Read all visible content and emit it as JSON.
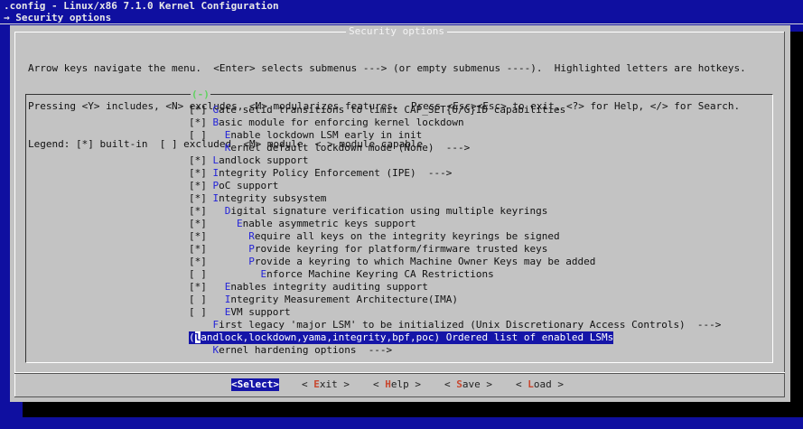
{
  "window": {
    "title_line": ".config - Linux/x86 7.1.0 Kernel Configuration",
    "breadcrumb": "→ Security options"
  },
  "dialog": {
    "title": "Security options",
    "help_lines": [
      "Arrow keys navigate the menu.  <Enter> selects submenus ---> (or empty submenus ----).  Highlighted letters are hotkeys.",
      "Pressing <Y> includes, <N> excludes, <M> modularizes features.  Press <Esc><Esc> to exit, <?> for Help, </> for Search.",
      "Legend: [*] built-in  [ ] excluded  <M> module  < > module capable"
    ],
    "scroll_indicator": "(-)",
    "items": [
      {
        "prefix": "[*] ",
        "hotkey": "G",
        "rest": "ate setid transitions to limit CAP_SET{U/G}ID capabilities"
      },
      {
        "prefix": "[*] ",
        "hotkey": "B",
        "rest": "asic module for enforcing kernel lockdown"
      },
      {
        "prefix": "[ ]   ",
        "hotkey": "E",
        "rest": "nable lockdown LSM early in init"
      },
      {
        "prefix": "      ",
        "hotkey": "K",
        "rest": "ernel default lockdown mode (None)  --->"
      },
      {
        "prefix": "[*] ",
        "hotkey": "L",
        "rest": "andlock support"
      },
      {
        "prefix": "[*] ",
        "hotkey": "I",
        "rest": "ntegrity Policy Enforcement (IPE)  --->"
      },
      {
        "prefix": "[*] ",
        "hotkey": "P",
        "rest": "oC support"
      },
      {
        "prefix": "[*] ",
        "hotkey": "I",
        "rest": "ntegrity subsystem"
      },
      {
        "prefix": "[*]   ",
        "hotkey": "D",
        "rest": "igital signature verification using multiple keyrings"
      },
      {
        "prefix": "[*]     ",
        "hotkey": "E",
        "rest": "nable asymmetric keys support"
      },
      {
        "prefix": "[*]       ",
        "hotkey": "R",
        "rest": "equire all keys on the integrity keyrings be signed"
      },
      {
        "prefix": "[*]       ",
        "hotkey": "P",
        "rest": "rovide keyring for platform/firmware trusted keys"
      },
      {
        "prefix": "[*]       ",
        "hotkey": "P",
        "rest": "rovide a keyring to which Machine Owner Keys may be added"
      },
      {
        "prefix": "[ ]         ",
        "hotkey": "E",
        "rest": "nforce Machine Keyring CA Restrictions"
      },
      {
        "prefix": "[*]   ",
        "hotkey": "E",
        "rest": "nables integrity auditing support"
      },
      {
        "prefix": "[ ]   ",
        "hotkey": "I",
        "rest": "ntegrity Measurement Architecture(IMA)"
      },
      {
        "prefix": "[ ]   ",
        "hotkey": "E",
        "rest": "VM support"
      },
      {
        "prefix": "    ",
        "hotkey": "F",
        "rest": "irst legacy 'major LSM' to be initialized (Unix Discretionary Access Controls)  --->"
      },
      {
        "prefix": "(",
        "hotkey": "l",
        "rest": "andlock,lockdown,yama,integrity,bpf,poc) Ordered list of enabled LSMs",
        "selected": true
      },
      {
        "prefix": "    ",
        "hotkey": "K",
        "rest": "ernel hardening options  --->"
      }
    ],
    "buttons": [
      {
        "label": "<Select>"
      },
      {
        "pre": "< ",
        "hotkey": "E",
        "post": "xit >"
      },
      {
        "pre": "< ",
        "hotkey": "H",
        "post": "elp >"
      },
      {
        "pre": "< ",
        "hotkey": "S",
        "post": "ave >"
      },
      {
        "pre": "< ",
        "hotkey": "L",
        "post": "oad >"
      }
    ]
  },
  "colors": {
    "background": "#0f0fa0",
    "dialog": "#c3c3c3",
    "hotkey": "#2323d8",
    "selection": "#1515a8",
    "button_hotkey": "#c8472f",
    "scroll_indicator": "#5fd35f"
  }
}
